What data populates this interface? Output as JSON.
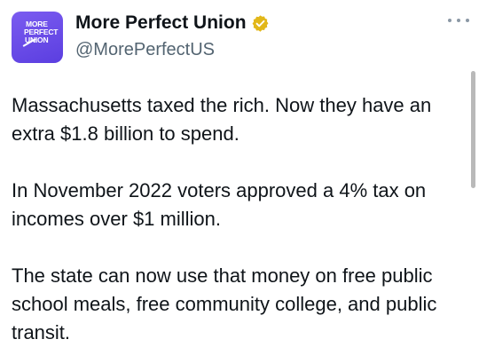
{
  "tweet": {
    "author": {
      "display_name": "More Perfect Union",
      "handle": "@MorePerfectUS",
      "verified": true,
      "avatar_lines": [
        "MORE",
        "PERFECT",
        "UNION"
      ],
      "avatar_color": "#6a4ae8",
      "verified_badge_color": "#e2b719"
    },
    "more_icon": "more-horizontal-icon",
    "paragraphs": [
      "Massachusetts taxed the rich. Now they have an extra $1.8 billion to spend.",
      "In November 2022 voters approved a 4% tax on incomes over $1 million.",
      "The state can now use that money on free public school meals, free community college, and public transit."
    ]
  }
}
